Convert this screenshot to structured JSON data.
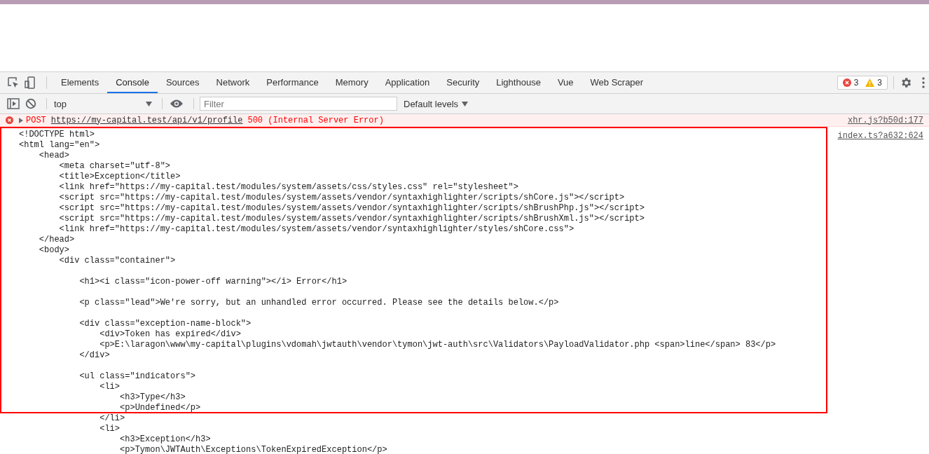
{
  "tabs": [
    {
      "label": "Elements",
      "selected": false
    },
    {
      "label": "Console",
      "selected": true
    },
    {
      "label": "Sources",
      "selected": false
    },
    {
      "label": "Network",
      "selected": false
    },
    {
      "label": "Performance",
      "selected": false
    },
    {
      "label": "Memory",
      "selected": false
    },
    {
      "label": "Application",
      "selected": false
    },
    {
      "label": "Security",
      "selected": false
    },
    {
      "label": "Lighthouse",
      "selected": false
    },
    {
      "label": "Vue",
      "selected": false
    },
    {
      "label": "Web Scraper",
      "selected": false
    }
  ],
  "counts": {
    "errors": "3",
    "warnings": "3"
  },
  "toolbar": {
    "context": "top",
    "filter_placeholder": "Filter",
    "levels": "Default levels"
  },
  "error_message": {
    "method": "POST",
    "url": "https://my-capital.test/api/v1/profile",
    "status": "500 (Internal Server Error)",
    "source": "xhr.js?b50d:177"
  },
  "log_message": {
    "source": "index.ts?a632:624",
    "blocks": [
      [
        "<!DOCTYPE html>",
        "<html lang=\"en\">",
        "    <head>",
        "        <meta charset=\"utf-8\">",
        "        <title>Exception</title>",
        "        <link href=\"https://my-capital.test/modules/system/assets/css/styles.css\" rel=\"stylesheet\">",
        "        <script src=\"https://my-capital.test/modules/system/assets/vendor/syntaxhighlighter/scripts/shCore.js\"></script>",
        "        <script src=\"https://my-capital.test/modules/system/assets/vendor/syntaxhighlighter/scripts/shBrushPhp.js\"></script>",
        "        <script src=\"https://my-capital.test/modules/system/assets/vendor/syntaxhighlighter/scripts/shBrushXml.js\"></script>",
        "        <link href=\"https://my-capital.test/modules/system/assets/vendor/syntaxhighlighter/styles/shCore.css\">",
        "    </head>",
        "    <body>",
        "        <div class=\"container\">"
      ],
      [
        "            <h1><i class=\"icon-power-off warning\"></i> Error</h1>"
      ],
      [
        "            <p class=\"lead\">We're sorry, but an unhandled error occurred. Please see the details below.</p>"
      ],
      [
        "            <div class=\"exception-name-block\">",
        "                <div>Token has expired</div>",
        "                <p>E:\\laragon\\www\\my-capital\\plugins\\vdomah\\jwtauth\\vendor\\tymon\\jwt-auth\\src\\Validators\\PayloadValidator.php <span>line</span> 83</p>",
        "            </div>"
      ],
      [
        "            <ul class=\"indicators\">",
        "                <li>",
        "                    <h3>Type</h3>",
        "                    <p>Undefined</p>",
        "                </li>",
        "                <li>",
        "                    <h3>Exception</h3>",
        "                    <p>Tymon\\JWTAuth\\Exceptions\\TokenExpiredException</p>"
      ]
    ]
  }
}
